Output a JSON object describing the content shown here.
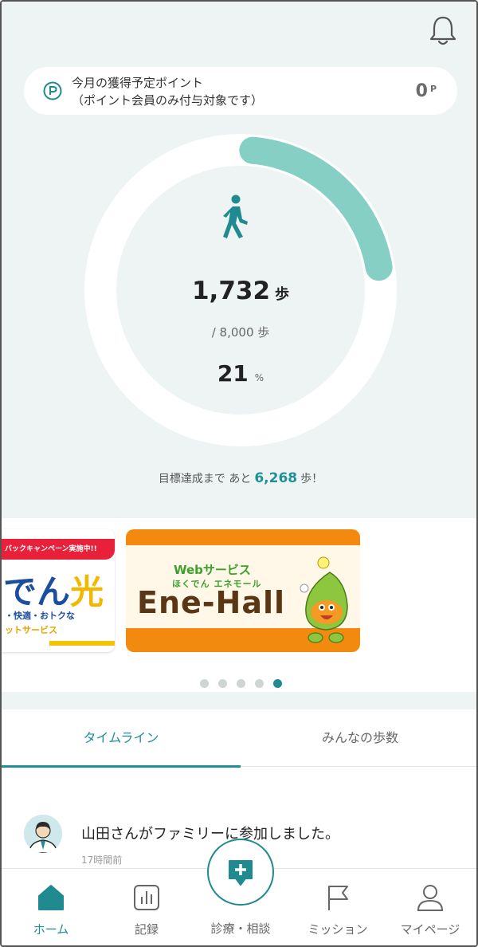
{
  "header": {
    "bell_icon": "bell-icon"
  },
  "points": {
    "icon": "p-circle-icon",
    "line1": "今月の獲得予定ポイント",
    "line2": "（ポイント会員のみ付与対象です）",
    "value": "0",
    "unit": "P"
  },
  "activity": {
    "icon": "walking-icon",
    "steps": "1,732",
    "steps_unit": "歩",
    "goal": "/ 8,000 歩",
    "percent": "21",
    "percent_unit": "%",
    "progress_fraction": 0.21,
    "remaining_prefix": "目標達成まで あと",
    "remaining": "6,268",
    "remaining_suffix": "歩！"
  },
  "banners": {
    "left": {
      "ribbon": "バックキャンペーン実施中!!",
      "big_text": "でん",
      "big_accent": "光",
      "line1": "・快適・おトクな",
      "line2": "ットサービス"
    },
    "right": {
      "web": "Webサービス",
      "sub": "ほくでん エネモール",
      "logo": "Ene-Hall"
    }
  },
  "carousel": {
    "count": 5,
    "active_index": 4
  },
  "tabs": [
    {
      "label": "タイムライン",
      "active": true
    },
    {
      "label": "みんなの歩数",
      "active": false
    }
  ],
  "timeline": [
    {
      "avatar": "user-avatar",
      "text": "山田さんがファミリーに参加しました。",
      "time": "17時間前"
    }
  ],
  "nav": {
    "items": [
      {
        "label": "ホーム",
        "icon": "home-icon",
        "active": true
      },
      {
        "label": "記録",
        "icon": "chart-icon",
        "active": false
      },
      {
        "label": "診療・相談",
        "icon": "medical-chat-icon",
        "active": false
      },
      {
        "label": "ミッション",
        "icon": "flag-icon",
        "active": false
      },
      {
        "label": "マイページ",
        "icon": "person-icon",
        "active": false
      }
    ]
  },
  "colors": {
    "accent": "#1f8a8f",
    "ring_track": "#ffffff",
    "ring_progress": "#86cfc4",
    "background": "#eef4f3"
  }
}
